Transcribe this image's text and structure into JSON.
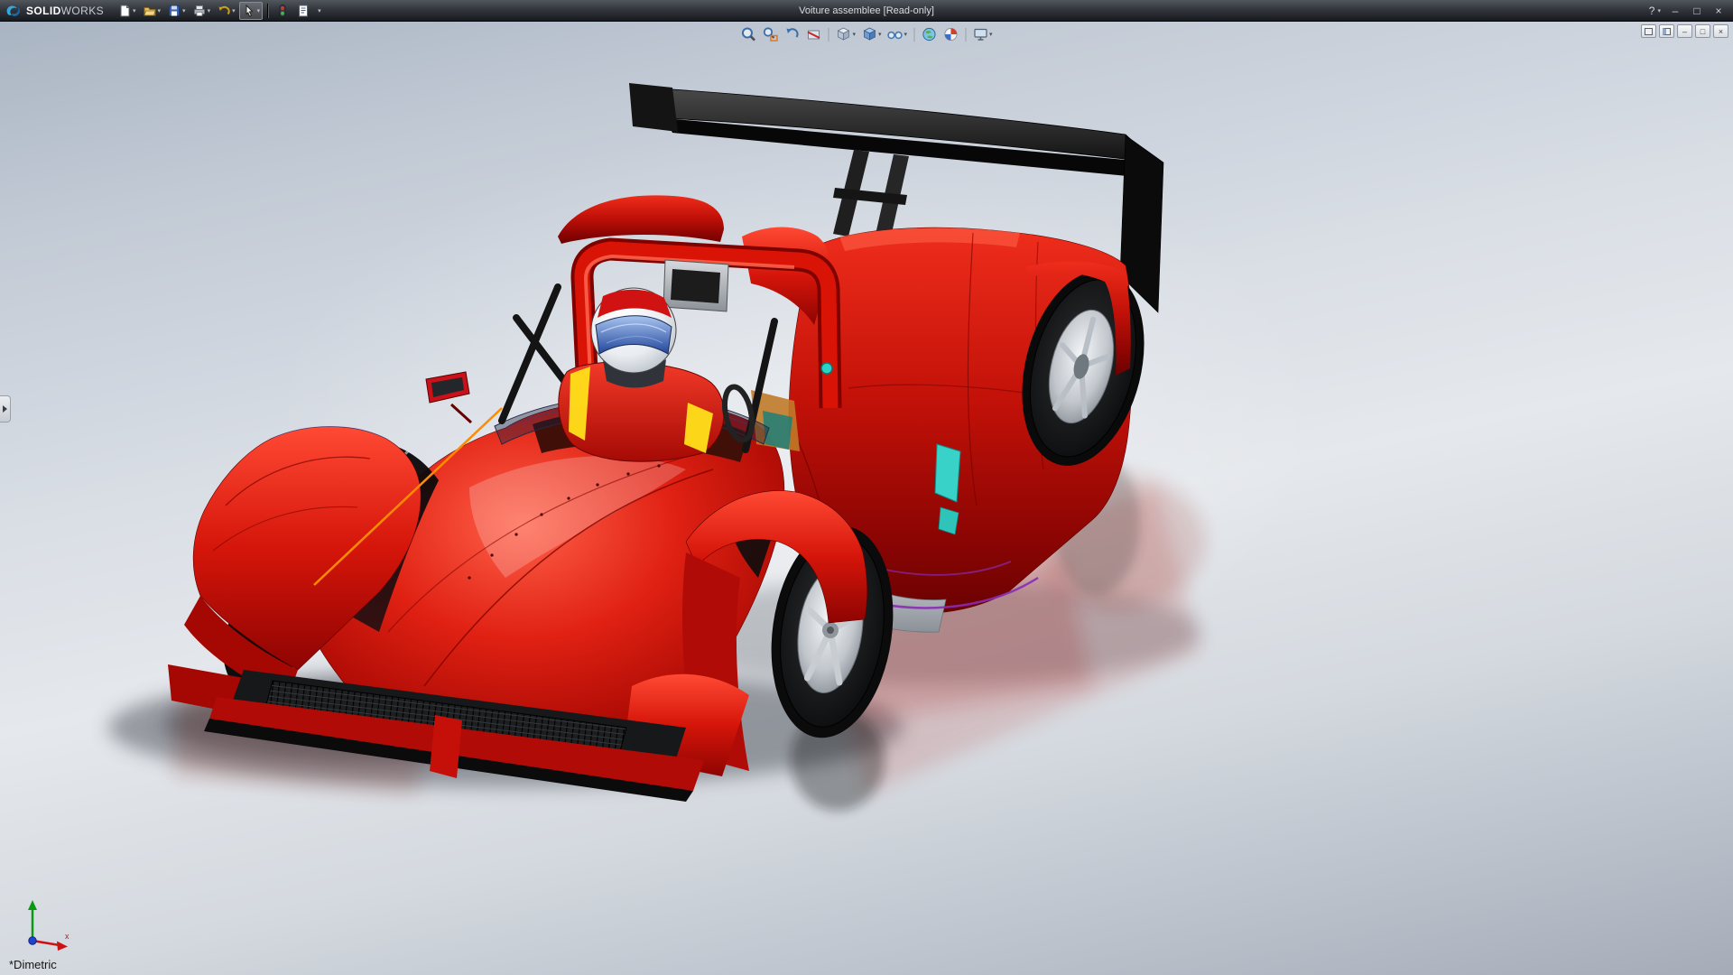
{
  "app": {
    "title": "Voiture assemblee [Read-only]",
    "brand": {
      "solid": "SOLID",
      "works": "WORKS"
    }
  },
  "titlebar": {
    "help_label": "?",
    "dropdown_glyph": "▾",
    "window_buttons": {
      "minimize": "–",
      "maximize": "□",
      "close": "×"
    },
    "toolbar_buttons": [
      "new",
      "open",
      "save",
      "print",
      "undo",
      "select",
      "rebuild",
      "file-properties",
      "toolbar-options"
    ]
  },
  "headsup_toolbar": {
    "dropdown_glyph": "▾",
    "items": [
      "zoom-to-fit",
      "zoom-to-area",
      "previous-view",
      "section-view",
      "view-orientation",
      "display-style",
      "hide-show-items",
      "apply-scene",
      "edit-appearance",
      "view-settings"
    ]
  },
  "document_controls": {
    "minimize": "–",
    "restore": "□",
    "close": "×"
  },
  "viewport": {
    "view_orientation_label": "*Dimetric",
    "triad": {
      "x_label": "x"
    },
    "model_colors": {
      "body_red": "#d31208",
      "wing_black": "#111111",
      "helmet_white": "#f4f6f8",
      "visor_blue": "#2a4a9a",
      "accent_cyan": "#2ad2c8",
      "accent_purple": "#8a2bb5",
      "sketch_orange": "#ff8c00"
    }
  }
}
